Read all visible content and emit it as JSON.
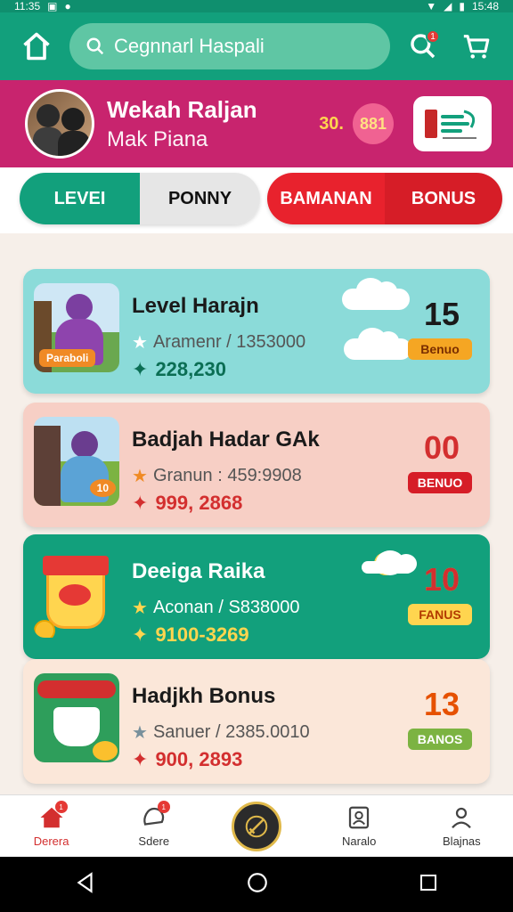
{
  "status_bar": {
    "time_left": "11:35",
    "time_right": "15:48"
  },
  "search": {
    "placeholder": "Cegnnarl Haspali"
  },
  "header": {
    "notification_count": "1"
  },
  "profile": {
    "name": "Wekah Raljan",
    "subtitle": "Mak Piana",
    "points_label": "30.",
    "points_value": "881"
  },
  "tabs": [
    {
      "label": "LEVEI"
    },
    {
      "label": "PONNY"
    },
    {
      "label": "BAMANAN"
    },
    {
      "label": "BONUS"
    }
  ],
  "cards": [
    {
      "title": "Level Harajn",
      "rating": "Aramenr / 1353000",
      "price": "228,230",
      "number": "15",
      "badge": "Benuo",
      "thumb_tag": "Paraboli"
    },
    {
      "title": "Badjah Hadar GAk",
      "rating": "Granun : 459:9908",
      "price": "999, 2868",
      "number": "00",
      "badge": "BENUO",
      "thumb_tag": "10"
    },
    {
      "title": "Deeiga Raika",
      "rating": "Aconan / S838000",
      "price": "9100-3269",
      "number": "10",
      "badge": "FANUS",
      "thumb_tag": ""
    },
    {
      "title": "Hadjkh Bonus",
      "rating": "Sanuer / 2385.0010",
      "price": "900, 2893",
      "number": "13",
      "badge": "BANOS",
      "thumb_tag": ""
    }
  ],
  "bottom_nav": [
    {
      "label": "Derera",
      "badge": "1"
    },
    {
      "label": "Sdere",
      "badge": "1"
    },
    {
      "label": ""
    },
    {
      "label": "Naralo"
    },
    {
      "label": "Blajnas"
    }
  ],
  "colors": {
    "primary": "#12a07c",
    "magenta": "#c8246e",
    "red": "#e8222d"
  }
}
